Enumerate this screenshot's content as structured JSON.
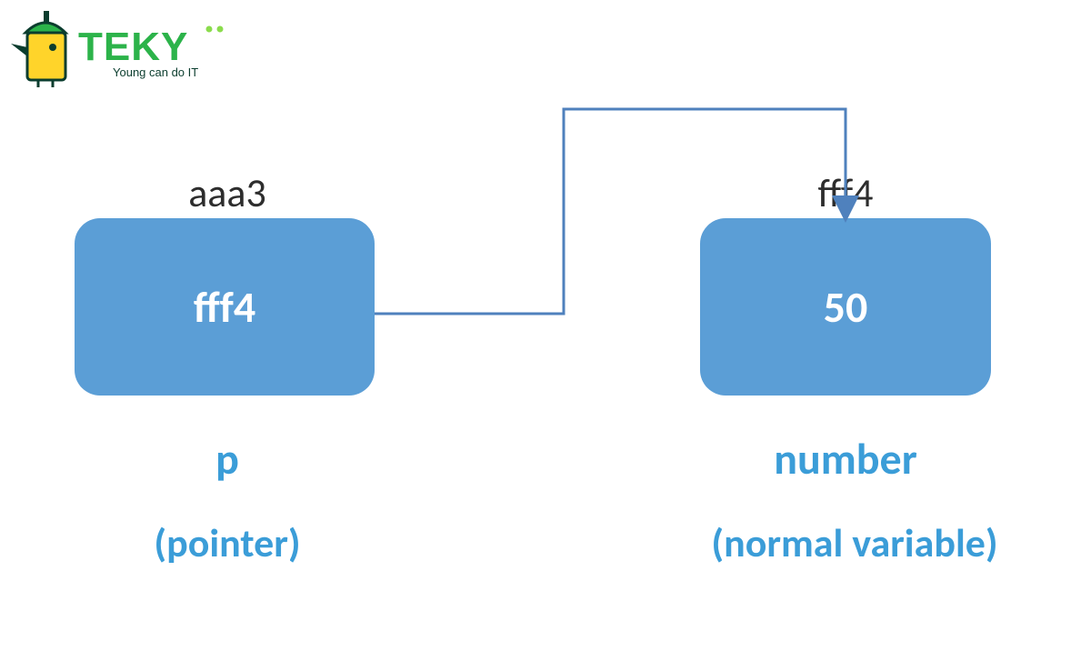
{
  "logo": {
    "brand_text": "TEKY",
    "tagline": "Young can do IT"
  },
  "pointer_box": {
    "address": "aaa3",
    "value": "fff4",
    "name": "p",
    "description": "(pointer)"
  },
  "variable_box": {
    "address": "fff4",
    "value": "50",
    "name": "number",
    "description": "(normal variable)"
  },
  "colors": {
    "box_fill": "#5b9ed6",
    "label_blue": "#3b9dd8",
    "arrow": "#4f81bd",
    "logo_green": "#2cb34a",
    "logo_yellow": "#ffd42a",
    "logo_dark": "#0b3d2e"
  }
}
